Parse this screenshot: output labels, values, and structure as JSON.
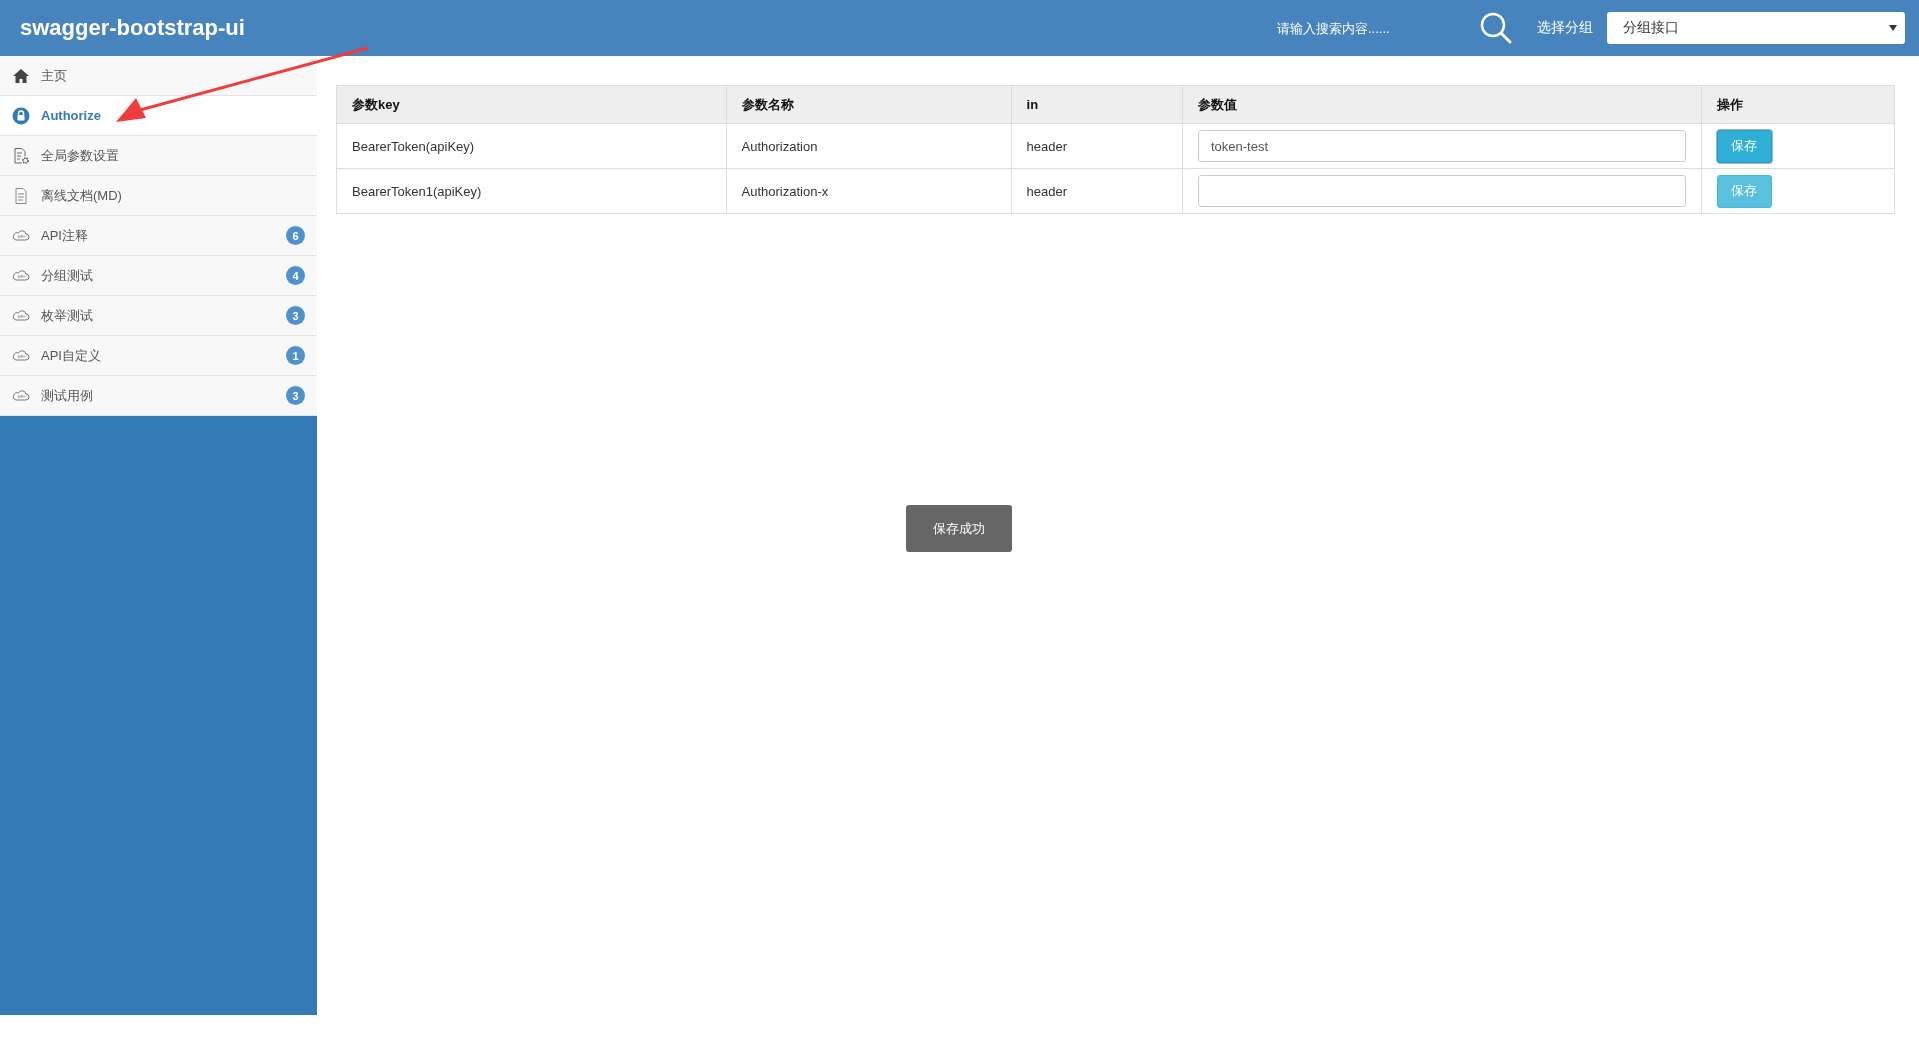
{
  "header": {
    "title": "swagger-bootstrap-ui",
    "search": {
      "placeholder": "请输入搜索内容......"
    },
    "group_label": "选择分组",
    "group_select": {
      "value": "分组接口"
    }
  },
  "sidebar": {
    "items": [
      {
        "kind": "home",
        "label": "主页",
        "selected": false
      },
      {
        "kind": "lock",
        "label": "Authorize",
        "selected": true
      },
      {
        "kind": "settings",
        "label": "全局参数设置",
        "selected": false
      },
      {
        "kind": "document",
        "label": "离线文档(MD)",
        "selected": false
      },
      {
        "kind": "api",
        "label": "API注释",
        "badge": "6",
        "selected": false
      },
      {
        "kind": "api",
        "label": "分组测试",
        "badge": "4",
        "selected": false
      },
      {
        "kind": "api",
        "label": "枚举测试",
        "badge": "3",
        "selected": false
      },
      {
        "kind": "api",
        "label": "API自定义",
        "badge": "1",
        "selected": false
      },
      {
        "kind": "api",
        "label": "测试用例",
        "badge": "3",
        "selected": false
      }
    ]
  },
  "table": {
    "columns": [
      "参数key",
      "参数名称",
      "in",
      "参数值",
      "操作"
    ],
    "rows": [
      {
        "key": "BearerToken(apiKey)",
        "name": "Authorization",
        "in": "header",
        "value": "token-test",
        "button": "保存",
        "focused": true
      },
      {
        "key": "BearerToken1(apiKey)",
        "name": "Authorization-x",
        "in": "header",
        "value": "",
        "button": "保存",
        "focused": false
      }
    ]
  },
  "toast": "保存成功"
}
